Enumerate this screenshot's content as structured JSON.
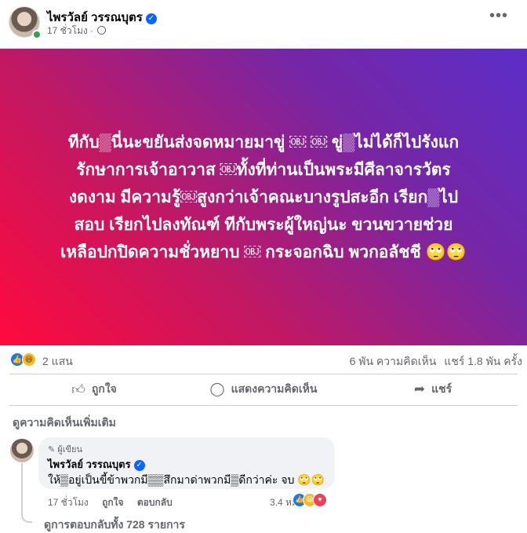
{
  "post": {
    "author": "ไพรวัลย์ วรรณบุตร",
    "time": "17 ชั่วโมง",
    "image_text": [
      "ทีกับ▒นี่นะขยันส่งจดหมายมาขู่ ￼ ￼ ขู่▒ไม่ได้ก็ไปรังแก",
      "รักษาการเจ้าอาวาส ￼ทั้งที่ท่านเป็นพระมีศีลาจารวัตร",
      "งดงาม มีความรู้￼สูงกว่าเจ้าคณะบางรูปสะอีก เรียก▒ไป",
      "สอบ เรียกไปลงทัณฑ์ ทีกับพระผู้ใหญ่นะ ขวนขวายช่วย",
      "เหลือปกปิดความชั่วหยาบ ￼ กระจอกฉิบ พวกอลัชชี 🙄🙄"
    ]
  },
  "stats": {
    "reactions": "2 แสน",
    "comments": "6 พัน ความคิดเห็น",
    "shares": "แชร์ 1.8 พัน ครั้ง"
  },
  "actions": {
    "like": "ถูกใจ",
    "comment": "แสดงความคิดเห็น",
    "share": "แชร์"
  },
  "comments_section": {
    "more_label": "ดูความคิดเห็นเพิ่มเติม",
    "comment": {
      "badge": "ผู้เขียน",
      "name": "ไพรวัลย์ วรรณบุตร",
      "text": "ให้▒อยู่เป็นขี้ข้าพวกมี▒▒สึกมาด่าพวกมี▒ดีกว่าค่ะ จบ 🙄🙄",
      "time": "17 ชั่วโมง",
      "like": "ถูกใจ",
      "reply": "ตอบกลับ",
      "reaction_count": "3.4 หมื่น"
    },
    "view_replies": "ดูการตอบกลับทั้ง 728 รายการ"
  }
}
